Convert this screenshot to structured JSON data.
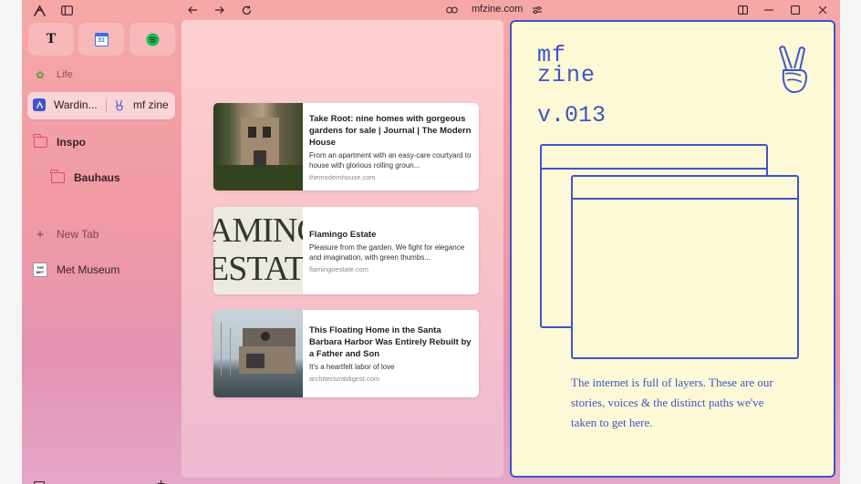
{
  "window": {
    "url": "mfzine.com"
  },
  "sidebar": {
    "favorites": [
      {
        "name": "nyt-favorite",
        "glyph": "𝕿"
      },
      {
        "name": "calendar-favorite",
        "glyph": "31"
      },
      {
        "name": "spotify-favorite",
        "glyph": ""
      }
    ],
    "space_label": "Life",
    "split_tab": {
      "left_label": "Wardin...",
      "right_label": "mf zine"
    },
    "folder": "Inspo",
    "subfolder": "Bauhaus",
    "new_tab": "New Tab",
    "tab_met": "Met Museum",
    "met_glyph": "THE MET"
  },
  "cards": [
    {
      "title": "Take Root: nine homes with gorgeous gardens for sale | Journal | The Modern House",
      "desc": "From an apartment with an easy-care courtyard to house with glorious rolling groun...",
      "domain": "themodernhouse.com"
    },
    {
      "title": "Flamingo Estate",
      "desc": "Pleasure from the garden. We fight for elegance and imagination, with green thumbs...",
      "domain": "flamingoestate.com",
      "thumb_text_1": "AMINC",
      "thumb_text_2": "ESTATI"
    },
    {
      "title": "This Floating Home in the Santa Barbara Harbor Was Entirely Rebuilt by a Father and Son",
      "desc": "It's a heartfelt labor of love",
      "domain": "architecturaldigest.com"
    }
  ],
  "zine": {
    "title_line1": "mf",
    "title_line2": "zine",
    "version": "v.013",
    "paragraph": "The internet is full of layers. These are our stories, voices & the distinct paths we've taken to get here."
  },
  "colors": {
    "accent": "#3f55c8",
    "zine_bg": "#fdf8d6",
    "folder": "#e0467c"
  }
}
